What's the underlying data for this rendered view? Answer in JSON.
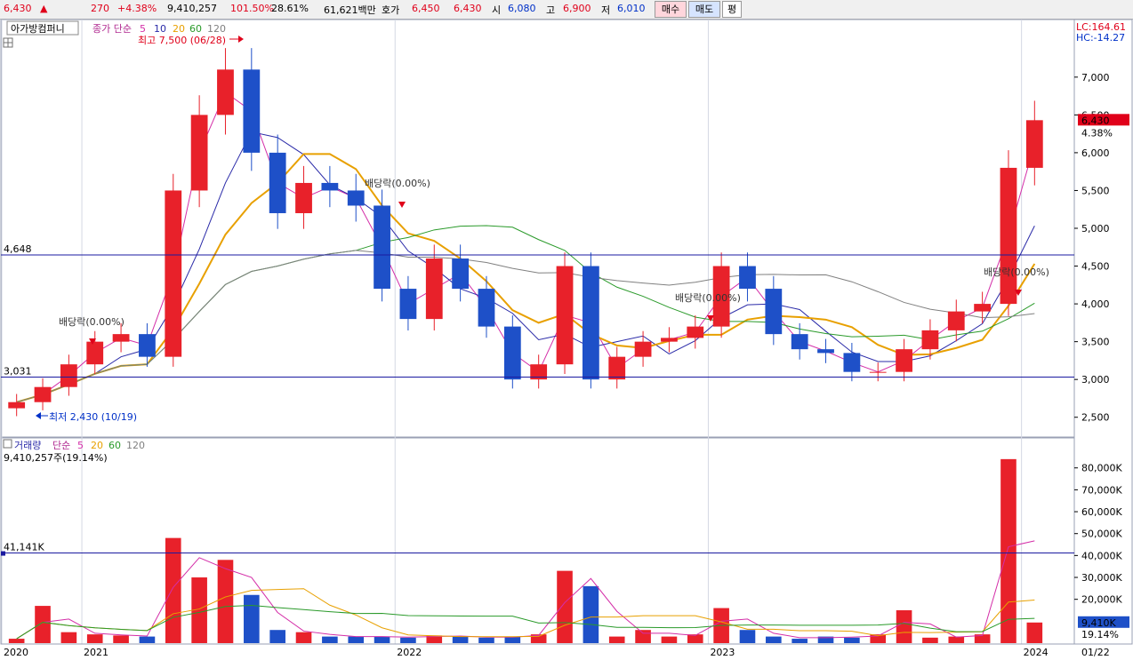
{
  "header": {
    "price": "6,430",
    "price_arrow": "▲",
    "change": "270",
    "change_pct": "+4.38%",
    "volume": "9,410,257",
    "volume_ratio": "101.50%",
    "turnover": "28.61%",
    "amount": "61,621백만",
    "quote_label": "호가",
    "ask": "6,450",
    "bid": "6,430",
    "open_label": "시",
    "open": "6,080",
    "high_label": "고",
    "high": "6,900",
    "low_label": "저",
    "low": "6,010",
    "buy_button": "매수",
    "sell_button": "매도",
    "avg_button": "평"
  },
  "price_panel": {
    "stock_name": "아가방컴퍼니",
    "ma_label": "종가 단순",
    "ma_periods": [
      "5",
      "10",
      "20",
      "60",
      "120"
    ],
    "lc_label": "LC:164.61",
    "hc_label": "HC:-14.27",
    "high_annotation": "최고 7,500 (06/28)",
    "low_annotation": "최저 2,430 (10/19)",
    "dividend_label": "배당락(0.00%)",
    "hline_upper": "4,648",
    "hline_lower": "3,031",
    "current_price_tag": "6,430",
    "current_pct_tag": "4.38%"
  },
  "volume_panel": {
    "title": "거래량",
    "ma_label": "단순",
    "ma_periods": [
      "5",
      "20",
      "60",
      "120"
    ],
    "current_volume": "9,410,257주(19.14%)",
    "hline_label": "41,141K",
    "current_tag": "9,410K",
    "current_pct_tag": "19.14%"
  },
  "x_axis": {
    "labels": [
      "2020",
      "2021",
      "2022",
      "2023",
      "2024"
    ],
    "right_date": "01/22"
  },
  "colors": {
    "up": "#e8212a",
    "down": "#1e50c8",
    "ma5": "#d42ea8",
    "ma10": "#2a2aa8",
    "ma20": "#e8a000",
    "ma60": "#2a9a2a",
    "ma120": "#808080",
    "hline": "#1a1aa0"
  },
  "chart_data": [
    {
      "type": "candlestick",
      "x": [
        "2020-10",
        "2020-11",
        "2020-12",
        "2021-01",
        "2021-02",
        "2021-03",
        "2021-04",
        "2021-05",
        "2021-06",
        "2021-07",
        "2021-08",
        "2021-09",
        "2021-10",
        "2021-11",
        "2021-12",
        "2022-01",
        "2022-02",
        "2022-03",
        "2022-04",
        "2022-05",
        "2022-06",
        "2022-07",
        "2022-08",
        "2022-09",
        "2022-10",
        "2022-11",
        "2022-12",
        "2023-01",
        "2023-02",
        "2023-03",
        "2023-04",
        "2023-05",
        "2023-06",
        "2023-07",
        "2023-08",
        "2023-09",
        "2023-10",
        "2023-11",
        "2023-12",
        "2024-01"
      ],
      "y_ticks": [
        2500,
        3000,
        3500,
        4000,
        4500,
        5000,
        5500,
        6000,
        6500,
        7000
      ],
      "ylim": [
        2250,
        7750
      ],
      "close": [
        2700,
        2900,
        3200,
        3500,
        3600,
        3300,
        5500,
        6500,
        7100,
        6000,
        5200,
        5600,
        5500,
        5300,
        4200,
        3800,
        4600,
        4200,
        3700,
        3000,
        3200,
        4500,
        3000,
        3300,
        3500,
        3550,
        3700,
        4500,
        4200,
        3600,
        3400,
        3350,
        3100,
        3100,
        3400,
        3650,
        3900,
        4000,
        5800,
        6430
      ],
      "high_point": {
        "value": 7500,
        "date": "06/28"
      },
      "low_point": {
        "value": 2430,
        "date": "10/19"
      },
      "hlines": [
        4648,
        3031
      ],
      "current": 6430
    },
    {
      "type": "bar",
      "name": "거래량",
      "y_ticks": [
        "20,000K",
        "30,000K",
        "40,000K",
        "50,000K",
        "60,000K",
        "70,000K",
        "80,000K"
      ],
      "ylim": [
        0,
        88000
      ],
      "unit": "K",
      "values": [
        2000,
        17000,
        5000,
        4000,
        3500,
        3000,
        48000,
        30000,
        38000,
        22000,
        6000,
        5000,
        3000,
        3000,
        3000,
        2500,
        3500,
        3000,
        2500,
        3000,
        4000,
        33000,
        26000,
        3000,
        6000,
        3000,
        4000,
        16000,
        6000,
        3000,
        2000,
        3000,
        2500,
        4000,
        15000,
        2500,
        3000,
        4000,
        84000,
        9410
      ],
      "hline": 41141,
      "current": 9410
    }
  ]
}
